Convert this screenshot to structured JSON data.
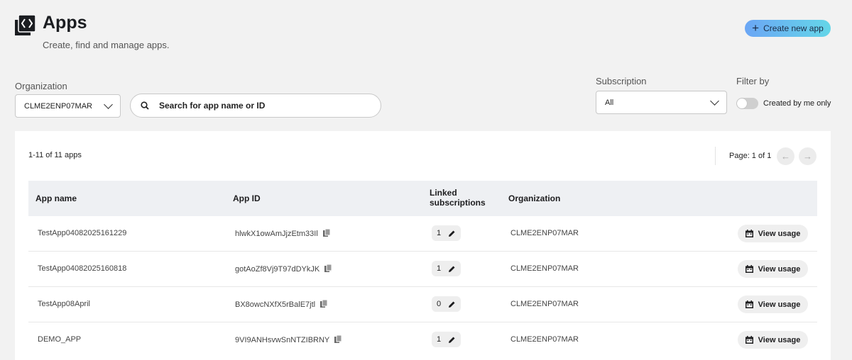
{
  "header": {
    "logo_icon": "code-brackets-icon",
    "title": "Apps",
    "subtitle": "Create, find and manage apps.",
    "create_label": "Create new app"
  },
  "filters": {
    "organization_label": "Organization",
    "organization_value": "CLME2ENP07MAR",
    "search_placeholder": "Search for app name or ID",
    "subscription_label": "Subscription",
    "subscription_value": "All",
    "filter_label": "Filter by",
    "created_by_me_label": "Created by me only",
    "created_by_me_on": false
  },
  "table": {
    "count_text": "1-11 of 11 apps",
    "page_text": "Page: 1 of 1",
    "headers": {
      "app_name": "App name",
      "app_id": "App ID",
      "linked_line1": "Linked",
      "linked_line2": "subscriptions",
      "organization": "Organization"
    },
    "view_usage_label": "View usage",
    "rows": [
      {
        "name": "TestApp04082025161229",
        "id": "hlwkX1owAmJjzEtm33Il",
        "linked": "1",
        "org": "CLME2ENP07MAR"
      },
      {
        "name": "TestApp04082025160818",
        "id": "gotAoZf8Vj9T97dDYkJK",
        "linked": "1",
        "org": "CLME2ENP07MAR"
      },
      {
        "name": "TestApp08April",
        "id": "BX8owcNXfX5rBalE7jtl",
        "linked": "0",
        "org": "CLME2ENP07MAR"
      },
      {
        "name": "DEMO_APP",
        "id": "9VI9ANHsvwSnNTZIBRNY",
        "linked": "1",
        "org": "CLME2ENP07MAR"
      }
    ]
  },
  "colors": {
    "accent_start": "#6ba6f5",
    "accent_end": "#64d6e8",
    "page_bg": "#f2f2f2"
  }
}
